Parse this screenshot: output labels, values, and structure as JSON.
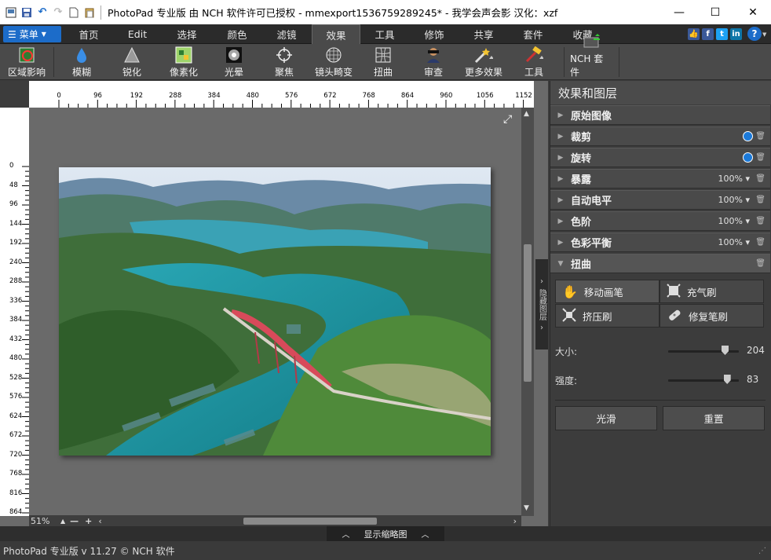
{
  "window": {
    "title": "PhotoPad 专业版 由 NCH 软件许可已授权  - mmexport1536759289245* - 我学会声会影   汉化：xzf",
    "controls": [
      "minimize",
      "maximize",
      "close"
    ]
  },
  "menu": {
    "label": "菜单",
    "tabs": [
      "首页",
      "Edit",
      "选择",
      "颜色",
      "滤镜",
      "效果",
      "工具",
      "修饰",
      "共享",
      "套件",
      "收藏"
    ],
    "active_tab": "效果",
    "help": "?"
  },
  "toolbar": {
    "tools": [
      {
        "label": "区域影响",
        "icon": "area-effect-icon"
      },
      {
        "label": "模糊",
        "icon": "blur-drop-icon"
      },
      {
        "label": "锐化",
        "icon": "sharpen-icon"
      },
      {
        "label": "像素化",
        "icon": "pixelate-icon"
      },
      {
        "label": "光晕",
        "icon": "glow-icon"
      },
      {
        "label": "聚焦",
        "icon": "focus-icon"
      },
      {
        "label": "镜头畸变",
        "icon": "lens-distortion-icon"
      },
      {
        "label": "扭曲",
        "icon": "distort-icon"
      },
      {
        "label": "审查",
        "icon": "censor-icon"
      },
      {
        "label": "更多效果",
        "icon": "more-effects-icon"
      },
      {
        "label": "工具",
        "icon": "tools-icon"
      },
      {
        "label": "NCH 套件",
        "icon": "nch-suite-icon"
      }
    ]
  },
  "rulers": {
    "top": [
      "0",
      "96",
      "192",
      "288",
      "384",
      "480",
      "576",
      "672",
      "768",
      "864",
      "960",
      "1056",
      "1152"
    ],
    "left": [
      "0",
      "48",
      "96",
      "144",
      "192",
      "240",
      "288",
      "336",
      "384",
      "432",
      "480",
      "528",
      "576",
      "624",
      "672",
      "720",
      "768",
      "816",
      "864"
    ]
  },
  "canvas": {
    "zoom": "51%"
  },
  "thumbnail_bar": {
    "label": "显示缩略图"
  },
  "statusbar": {
    "text": "PhotoPad 专业版 v 11.27 © NCH 软件"
  },
  "side_tab": {
    "label": "隐藏图层"
  },
  "panel": {
    "title": "效果和图层",
    "layers": [
      {
        "name": "原始图像",
        "percent": "",
        "eye": false,
        "trash": false
      },
      {
        "name": "裁剪",
        "percent": "",
        "eye": true,
        "trash": true
      },
      {
        "name": "旋转",
        "percent": "",
        "eye": true,
        "trash": true
      },
      {
        "name": "暴露",
        "percent": "100%",
        "eye": false,
        "trash": true
      },
      {
        "name": "自动电平",
        "percent": "100%",
        "eye": false,
        "trash": true
      },
      {
        "name": "色阶",
        "percent": "100%",
        "eye": false,
        "trash": true
      },
      {
        "name": "色彩平衡",
        "percent": "100%",
        "eye": false,
        "trash": true
      },
      {
        "name": "扭曲",
        "percent": "",
        "eye": false,
        "trash": true,
        "expanded": true
      }
    ],
    "brushes": [
      {
        "label": "移动画笔",
        "icon": "hand-icon",
        "selected": true
      },
      {
        "label": "充气刷",
        "icon": "inflate-icon",
        "selected": false
      },
      {
        "label": "挤压刷",
        "icon": "pinch-icon",
        "selected": false
      },
      {
        "label": "修复笔刷",
        "icon": "bandage-icon",
        "selected": false
      }
    ],
    "size": {
      "label": "大小:",
      "value": "204",
      "level": 0.8
    },
    "strength": {
      "label": "强度:",
      "value": "83",
      "level": 0.83
    },
    "smooth_label": "光滑",
    "reset_label": "重置"
  }
}
